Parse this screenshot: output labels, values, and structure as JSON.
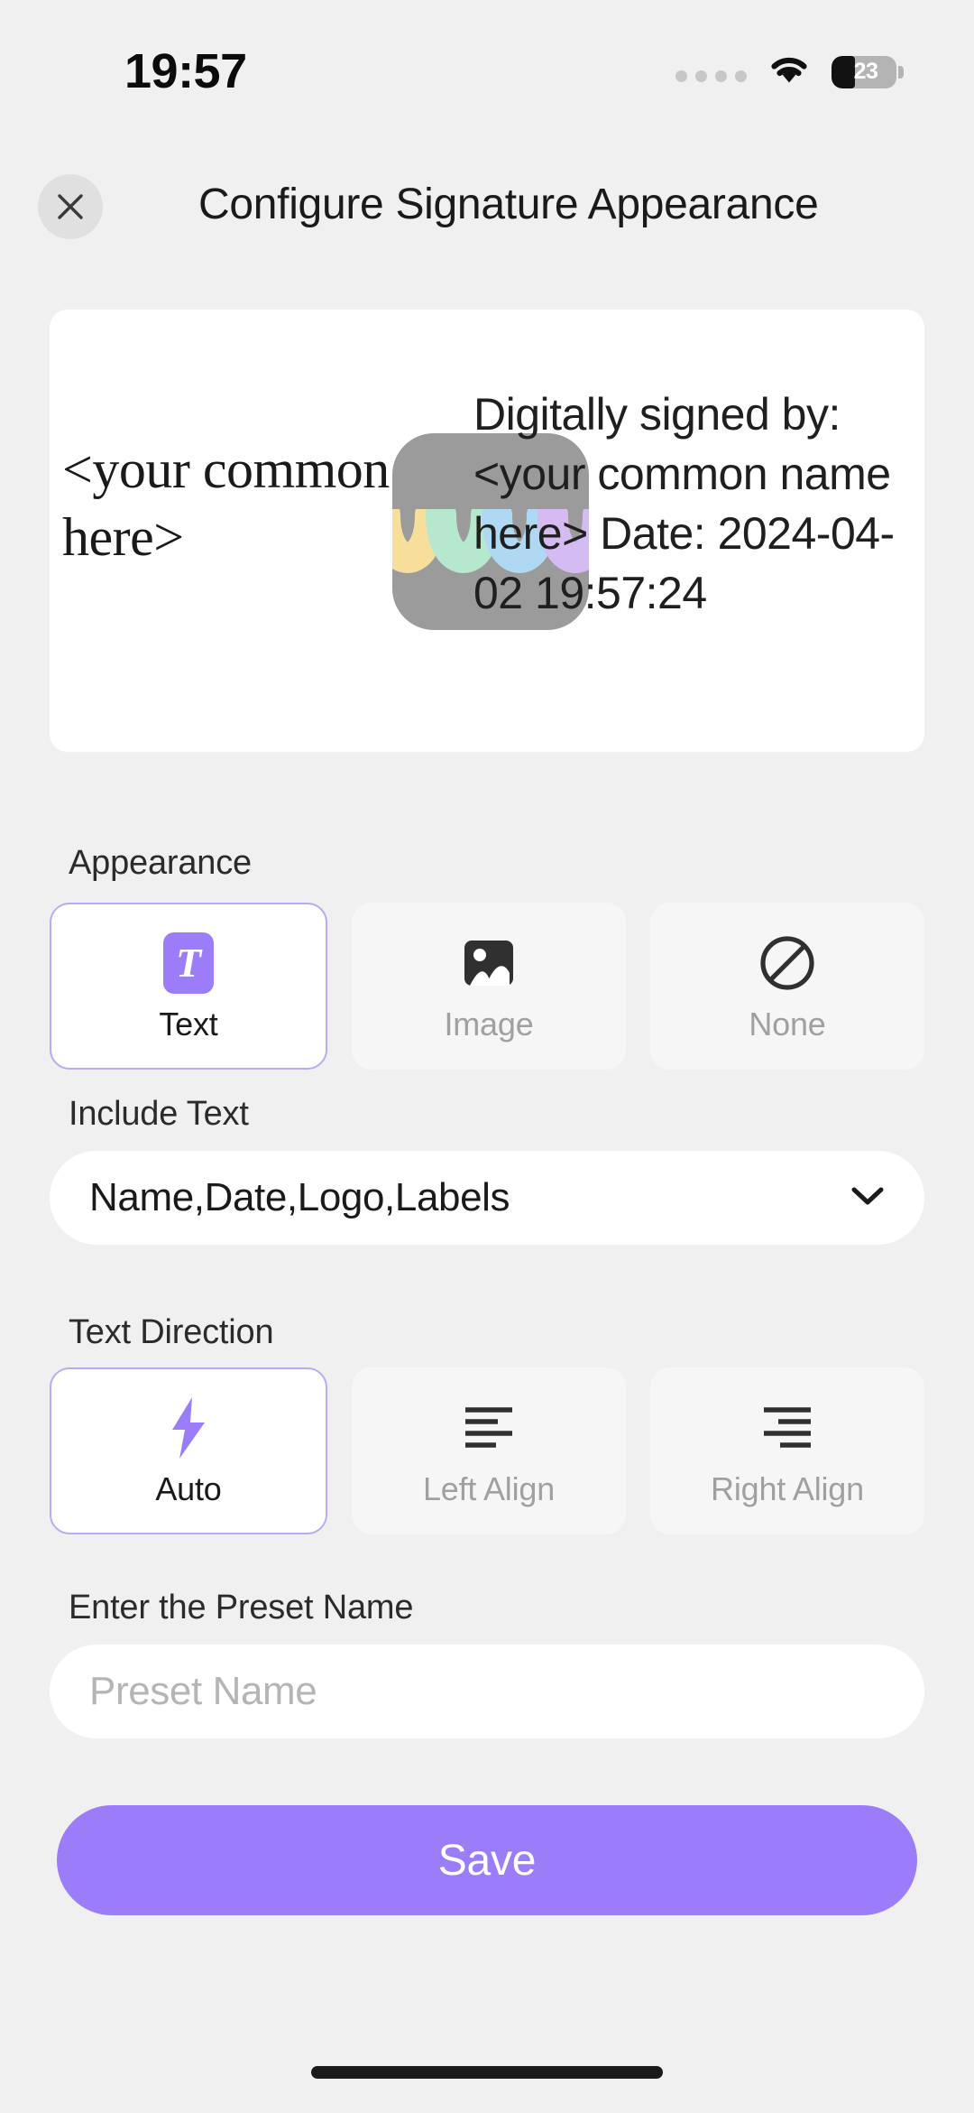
{
  "status_bar": {
    "time": "19:57",
    "battery_percent": "23",
    "signal_icon": "signal-dots-icon",
    "wifi_icon": "wifi-icon",
    "battery_icon": "battery-icon"
  },
  "header": {
    "title": "Configure Signature Appearance",
    "close_icon": "close-icon"
  },
  "preview": {
    "signature_name": "<your common name here>",
    "logo_icon": "signature-logo-icon",
    "details": "Digitally signed by: <your common name here> Date: 2024-04-02 19:57:24",
    "detail_lines": [
      "Digitally signed by:",
      "<your common name here>",
      "Date: 2024-04-02 19:57:24"
    ]
  },
  "appearance": {
    "label": "Appearance",
    "options": [
      {
        "label": "Text",
        "icon": "text-badge-icon",
        "selected": true
      },
      {
        "label": "Image",
        "icon": "image-icon",
        "selected": false
      },
      {
        "label": "None",
        "icon": "prohibited-icon",
        "selected": false
      }
    ]
  },
  "include_text": {
    "label": "Include Text",
    "value": "Name,Date,Logo,Labels",
    "chevron_icon": "chevron-down-icon"
  },
  "text_direction": {
    "label": "Text Direction",
    "options": [
      {
        "label": "Auto",
        "icon": "lightning-bolt-icon",
        "selected": true
      },
      {
        "label": "Left Align",
        "icon": "align-left-icon",
        "selected": false
      },
      {
        "label": "Right Align",
        "icon": "align-right-icon",
        "selected": false
      }
    ]
  },
  "preset": {
    "label": "Enter the Preset Name",
    "value": "",
    "placeholder": "Preset Name"
  },
  "save": {
    "label": "Save"
  },
  "colors": {
    "accent_purple": "#9B7DFA",
    "selected_border": "#BCA8F5",
    "page_background": "#F0F0F0",
    "card_background": "#FFFFFF",
    "option_background": "#F6F6F6",
    "muted_text": "#A0A0A0",
    "logo_background": "#9B9B9B",
    "logo_wave_colors": [
      "#F7DF9B",
      "#B6E8CE",
      "#AFD9F2",
      "#D4BBF2"
    ]
  }
}
